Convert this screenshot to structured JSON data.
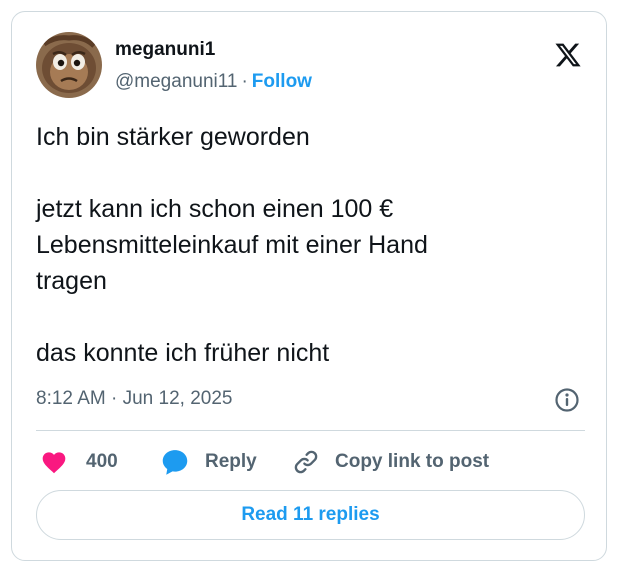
{
  "user": {
    "display_name": "meganuni1",
    "handle": "@meganuni11",
    "separator": "·",
    "follow_label": "Follow"
  },
  "tweet": {
    "text": "Ich bin stärker geworden\n\njetzt kann ich schon einen 100 €\nLebensmitteleinkauf mit einer Hand\ntragen\n\ndas konnte ich früher nicht",
    "timestamp": "8:12 AM · Jun 12, 2025"
  },
  "actions": {
    "like_count": "400",
    "reply_label": "Reply",
    "copy_label": "Copy link to post"
  },
  "read_replies_label": "Read 11 replies",
  "icons": {
    "logo": "x-logo-icon",
    "info": "info-icon",
    "like": "heart-icon",
    "reply": "speech-bubble-icon",
    "copy": "link-icon"
  },
  "colors": {
    "accent": "#1d9bf0",
    "like": "#f91880",
    "muted": "#536471",
    "border": "#cfd9de"
  }
}
